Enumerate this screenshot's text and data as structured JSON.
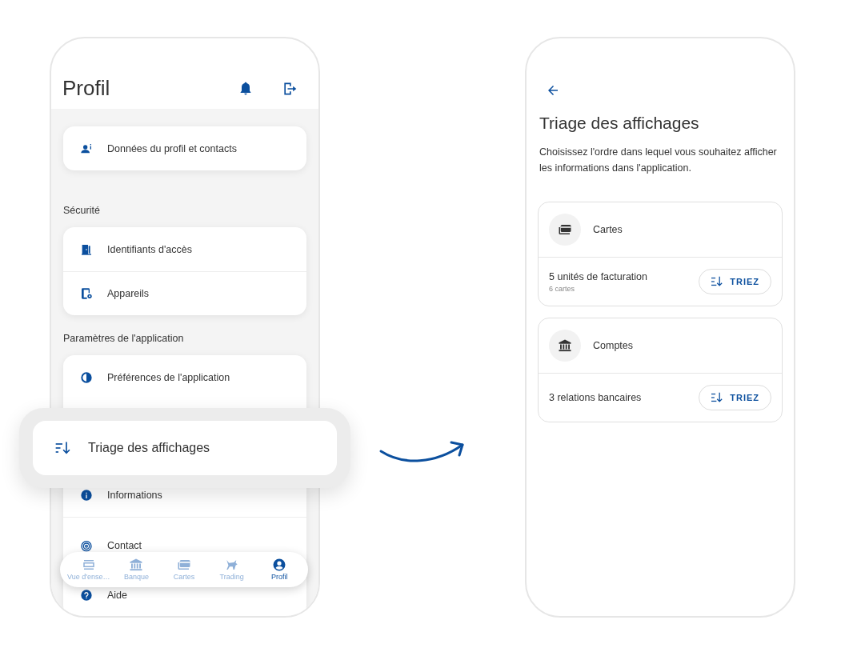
{
  "profile_screen": {
    "title": "Profil",
    "sections": [
      {
        "items": [
          {
            "label": "Données du profil et contacts",
            "highlighted": false
          }
        ]
      },
      {
        "title": "Sécurité",
        "items": [
          {
            "label": "Identifiants d'accès",
            "highlighted": false
          },
          {
            "label": "Appareils",
            "highlighted": false
          }
        ]
      },
      {
        "title": "Paramètres de l'application",
        "items": [
          {
            "label": "Préférences de l'application",
            "highlighted": false
          },
          {
            "label": "Triage des affichages",
            "highlighted": true
          },
          {
            "label": "Informations",
            "highlighted": false
          },
          {
            "label": "Contact",
            "highlighted": false
          },
          {
            "label": "Aide",
            "highlighted": false
          }
        ]
      }
    ],
    "bottom_nav": [
      {
        "label": "Vue d'ense…",
        "selected": false
      },
      {
        "label": "Banque",
        "selected": false
      },
      {
        "label": "Cartes",
        "selected": false
      },
      {
        "label": "Trading",
        "selected": false
      },
      {
        "label": "Profil",
        "selected": true
      }
    ]
  },
  "sort_screen": {
    "title": "Triage des affichages",
    "description": "Choisissez l'ordre dans lequel vous souhaitez afficher les informations dans l'application.",
    "groups": [
      {
        "title": "Cartes",
        "summary": "5 unités de facturation",
        "detail": "6 cartes",
        "button": "TRIEZ"
      },
      {
        "title": "Comptes",
        "summary": "3 relations bancaires",
        "button": "TRIEZ"
      }
    ]
  }
}
